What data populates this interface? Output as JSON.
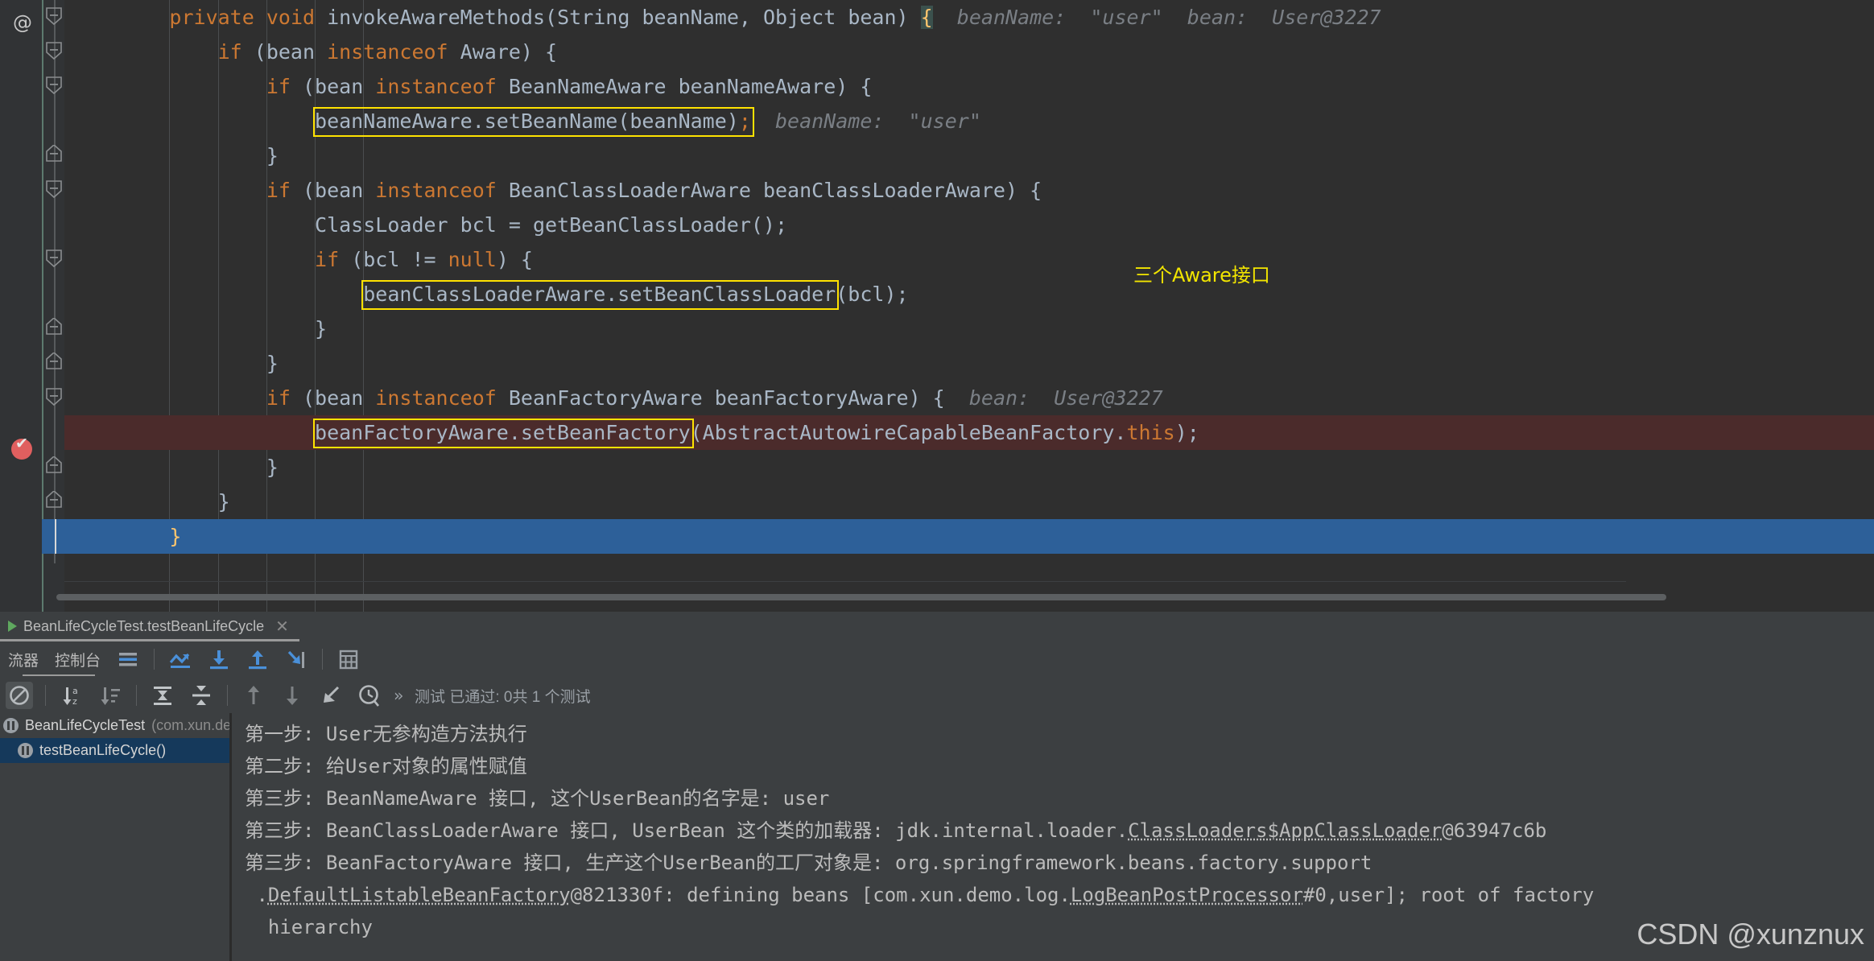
{
  "editor": {
    "gutter_annotation_icon": "at-sign-icon",
    "breakpoint_icon": "breakpoint-verified-icon",
    "yellow_note": "三个Aware接口",
    "lines": [
      {
        "indent": 2,
        "segments": [
          {
            "t": "private ",
            "c": "kw"
          },
          {
            "t": "void ",
            "c": "kw"
          },
          {
            "t": "invokeAwareMethods",
            "c": "mth"
          },
          {
            "t": "(String beanName, Object bean) ",
            "c": "pun"
          },
          {
            "t": "{",
            "c": "brace-hl"
          }
        ],
        "hints": [
          "beanName:  \"user\"",
          "bean:  User@3227"
        ]
      },
      {
        "indent": 3,
        "segments": [
          {
            "t": "if ",
            "c": "kw"
          },
          {
            "t": "(bean ",
            "c": "pun"
          },
          {
            "t": "instanceof ",
            "c": "kw"
          },
          {
            "t": "Aware) {",
            "c": "pun"
          }
        ],
        "hints": []
      },
      {
        "indent": 4,
        "segments": [
          {
            "t": "if ",
            "c": "kw"
          },
          {
            "t": "(bean ",
            "c": "pun"
          },
          {
            "t": "instanceof ",
            "c": "kw"
          },
          {
            "t": "BeanNameAware beanNameAware) {",
            "c": "pun"
          }
        ],
        "hints": []
      },
      {
        "indent": 5,
        "segments": [
          {
            "t": "beanNameAware.setBeanName(beanName)",
            "c": "pun"
          },
          {
            "t": ";",
            "c": "semi"
          }
        ],
        "boxed": true,
        "hints": [
          "beanName:  \"user\""
        ]
      },
      {
        "indent": 4,
        "segments": [
          {
            "t": "}",
            "c": "pun"
          }
        ],
        "hints": []
      },
      {
        "indent": 4,
        "segments": [
          {
            "t": "if ",
            "c": "kw"
          },
          {
            "t": "(bean ",
            "c": "pun"
          },
          {
            "t": "instanceof ",
            "c": "kw"
          },
          {
            "t": "BeanClassLoaderAware beanClassLoaderAware) {",
            "c": "pun"
          }
        ],
        "hints": []
      },
      {
        "indent": 5,
        "segments": [
          {
            "t": "ClassLoader bcl = getBeanClassLoader();",
            "c": "pun"
          }
        ],
        "hints": []
      },
      {
        "indent": 5,
        "segments": [
          {
            "t": "if ",
            "c": "kw"
          },
          {
            "t": "(bcl != ",
            "c": "pun"
          },
          {
            "t": "null",
            "c": "kw"
          },
          {
            "t": ") {",
            "c": "pun"
          }
        ],
        "hints": []
      },
      {
        "indent": 6,
        "segments": [
          {
            "t": "beanClassLoaderAware.setBeanClassLoader",
            "c": "pun"
          },
          {
            "t": "(bcl);",
            "c": "pun"
          }
        ],
        "boxed": true,
        "hints": []
      },
      {
        "indent": 5,
        "segments": [
          {
            "t": "}",
            "c": "pun"
          }
        ],
        "hints": []
      },
      {
        "indent": 4,
        "segments": [
          {
            "t": "}",
            "c": "pun"
          }
        ],
        "hints": []
      },
      {
        "indent": 4,
        "segments": [
          {
            "t": "if ",
            "c": "kw"
          },
          {
            "t": "(bean ",
            "c": "pun"
          },
          {
            "t": "instanceof ",
            "c": "kw"
          },
          {
            "t": "BeanFactoryAware beanFactoryAware) {",
            "c": "pun"
          }
        ],
        "hints": [
          "bean:  User@3227"
        ]
      },
      {
        "indent": 5,
        "segments": [
          {
            "t": "beanFactoryAware.setBeanFactory",
            "c": "pun"
          },
          {
            "t": "(AbstractAutowireCapableBeanFactory.",
            "c": "pun"
          },
          {
            "t": "this",
            "c": "kw"
          },
          {
            "t": ");",
            "c": "pun"
          }
        ],
        "boxed": true,
        "executing": true,
        "hints": []
      },
      {
        "indent": 4,
        "segments": [
          {
            "t": "}",
            "c": "pun"
          }
        ],
        "hints": []
      },
      {
        "indent": 3,
        "segments": [
          {
            "t": "}",
            "c": "pun"
          }
        ],
        "hints": []
      },
      {
        "indent": 2,
        "segments": [
          {
            "t": "}",
            "c": "brace-y"
          }
        ],
        "selected": true,
        "hints": []
      }
    ]
  },
  "run_window": {
    "tab": {
      "label": "BeanLifeCycleTest.testBeanLifeCycle",
      "run_icon": "run-play-icon",
      "close_icon": "close-icon"
    },
    "toolbar1": {
      "left_partial_label": "流器",
      "console_label": "控制台",
      "buttons": [
        {
          "name": "wrap-text-icon",
          "label": ""
        },
        {
          "name": "rerun-failed-tests-icon",
          "label": ""
        },
        {
          "name": "scroll-down-icon",
          "label": ""
        },
        {
          "name": "scroll-up-icon",
          "label": ""
        },
        {
          "name": "jump-to-end-icon",
          "label": ""
        },
        {
          "name": "print-icon",
          "label": ""
        }
      ]
    },
    "toolbar2": {
      "buttons": [
        {
          "name": "hide-passed-icon",
          "label": ""
        },
        {
          "name": "sort-alphabetically-icon",
          "label": ""
        },
        {
          "name": "sort-by-duration-icon",
          "label": ""
        },
        {
          "name": "expand-all-icon",
          "label": ""
        },
        {
          "name": "collapse-all-icon",
          "label": ""
        },
        {
          "name": "prev-failed-icon",
          "label": ""
        },
        {
          "name": "next-failed-icon",
          "label": ""
        },
        {
          "name": "import-tests-icon",
          "label": ""
        },
        {
          "name": "test-history-icon",
          "label": ""
        }
      ],
      "overflow_icon": "chevron-double-right-icon",
      "status": "测试 已通过: 0共 1 个测试"
    },
    "test_tree": [
      {
        "label": "BeanLifeCycleTest",
        "package": "(com.xun.demo)",
        "selected": false,
        "indent": false,
        "icon": "test-paused-icon"
      },
      {
        "label": "testBeanLifeCycle()",
        "package": "",
        "selected": true,
        "indent": true,
        "icon": "test-paused-icon"
      }
    ],
    "console_lines": [
      [
        {
          "t": "第一步: User无参构造方法执行"
        }
      ],
      [
        {
          "t": "第二步: 给User对象的属性赋值"
        }
      ],
      [
        {
          "t": "第三步: BeanNameAware 接口, 这个UserBean的名字是: user"
        }
      ],
      [
        {
          "t": "第三步: BeanClassLoaderAware 接口, UserBean 这个类的加载器: jdk.internal.loader."
        },
        {
          "t": "ClassLoaders$AppClassLoader",
          "link": true
        },
        {
          "t": "@63947c6b"
        }
      ],
      [
        {
          "t": "第三步: BeanFactoryAware 接口, 生产这个UserBean的工厂对象是: org.springframework.beans.factory.support"
        }
      ],
      [
        {
          "t": " ."
        },
        {
          "t": "DefaultListableBeanFactory",
          "link": true
        },
        {
          "t": "@821330f: defining beans [com.xun.demo.log."
        },
        {
          "t": "LogBeanPostProcessor",
          "link": true
        },
        {
          "t": "#0,user]; root of factory"
        }
      ],
      [
        {
          "t": "  hierarchy"
        }
      ]
    ]
  },
  "watermark": "CSDN @xunznux",
  "colors": {
    "editor_bg": "#2f2f2f",
    "gutter_bg": "#313335",
    "panel_bg": "#3c3f41",
    "keyword": "#cc7832",
    "identifier": "#a9b7c6",
    "hint": "#7a7f85",
    "highlight_box": "#ffe200",
    "selection": "#2d6099",
    "executing_line": "#4b2b2b",
    "breakpoint": "#e05f5f",
    "accent_blue": "#4a90d9"
  }
}
